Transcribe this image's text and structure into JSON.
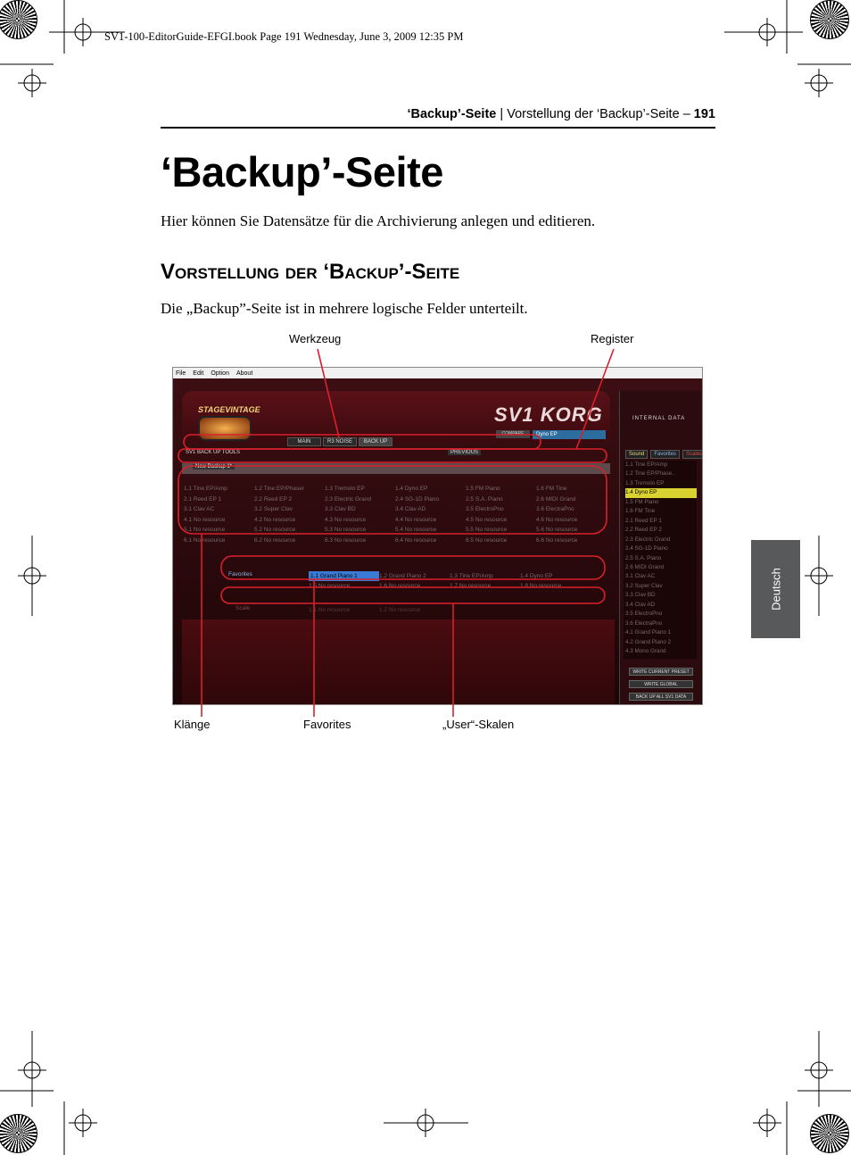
{
  "book_line": "SV1-100-EditorGuide-EFGI.book  Page 191  Wednesday, June 3, 2009  12:35 PM",
  "running_head": {
    "section_bold": "‘Backup’-Seite",
    "separator": "|",
    "subsection": "Vorstellung der ‘Backup’-Seite",
    "dash": "–",
    "page_number": "191"
  },
  "title": "‘Backup’-Seite",
  "intro": "Hier können Sie Datensätze für die Archivierung anlegen und editieren.",
  "subheading": "Vorstellung der ‘Backup’-Seite",
  "intro2": "Die „Backup”-Seite ist in mehrere logische Felder unterteilt.",
  "thumb_tab": "Deutsch",
  "callouts": {
    "werkzeug": "Werkzeug",
    "register": "Register",
    "klaenge": "Klänge",
    "favorites": "Favorites",
    "user_skalen": "„User“-Skalen"
  },
  "screenshot": {
    "menu": [
      "File",
      "Edit",
      "Option",
      "About"
    ],
    "logo": "STAGEVINTAGE",
    "brand": "SV1 KORG",
    "tabs": [
      "MAIN",
      "R3 NOISE",
      "BACK UP"
    ],
    "compare": "COMPARE",
    "preset": "Dyno EP",
    "toolbar_label": "SV1  BACK UP TOOLS",
    "previous": "PREVIOUS",
    "backup_tab": "New Backup 1*",
    "sounds": [
      [
        "1.1  Tine EP/Amp",
        "1.2  Tine EP/Phaser",
        "1.3  Tremolo EP",
        "1.4  Dyno EP",
        "1.5  FM Piano",
        "1.6  FM Tine"
      ],
      [
        "2.1  Reed EP 1",
        "2.2  Reed EP 2",
        "2.3  Electric Grand",
        "2.4  SG-1D Piano",
        "2.5  S.A. Piano",
        "2.6  MIDI Grand"
      ],
      [
        "3.1  Clav AC",
        "3.2  Super Clav",
        "3.3  Clav BD",
        "3.4  Clav AD",
        "3.5  ElectroPno",
        "3.6  ElectraPno"
      ],
      [
        "4.1  No resource",
        "4.2  No resource",
        "4.3  No resource",
        "4.4  No resource",
        "4.5  No resource",
        "4.6  No resource"
      ],
      [
        "5.1  No resource",
        "5.2  No resource",
        "5.3  No resource",
        "5.4  No resource",
        "5.5  No resource",
        "5.6  No resource"
      ],
      [
        "6.1  No resource",
        "6.2  No resource",
        "6.3  No resource",
        "6.4  No resource",
        "6.5  No resource",
        "6.6  No resource"
      ]
    ],
    "favorites_label": "Favorites",
    "favorites": [
      [
        "1.1  Grand Piano 1",
        "1.2  Grand Piano 2",
        "1.3  Tine EP/Amp",
        "1.4  Dyno EP"
      ],
      [
        "1.5  No resource",
        "1.6  No resource",
        "1.7  No resource",
        "1.8  No resource"
      ]
    ],
    "scale_label": "Scale",
    "scales": [
      "1.1  No resource",
      "1.2  No resource"
    ],
    "side_title": "INTERNAL DATA",
    "side_tabs": [
      "Sound",
      "Favorites",
      "Scales"
    ],
    "side_list": [
      "1.1  Tine EP/Amp",
      "1.2  Tine EP/Phase..",
      "1.3  Tremolo EP",
      "1.4  Dyno EP",
      "1.5  FM Piano",
      "1.6  FM Tine",
      "2.1  Reed EP 1",
      "2.2  Reed EP 2",
      "2.3  Electric Grand",
      "2.4  SG-1D Piano",
      "2.5  S.A. Piano",
      "2.6  MIDI Grand",
      "3.1  Clav AC",
      "3.2  Super Clav",
      "3.3  Clav BD",
      "3.4  Clav AD",
      "3.5  ElectroPno",
      "3.6  ElectraPno",
      "4.1  Grand Piano 1",
      "4.2  Grand Piano 2",
      "4.3  Mono Grand"
    ],
    "side_buttons": [
      "WRITE CURRENT PRESET",
      "WRITE GLOBAL",
      "BACK UP ALL SV1 DATA"
    ]
  }
}
